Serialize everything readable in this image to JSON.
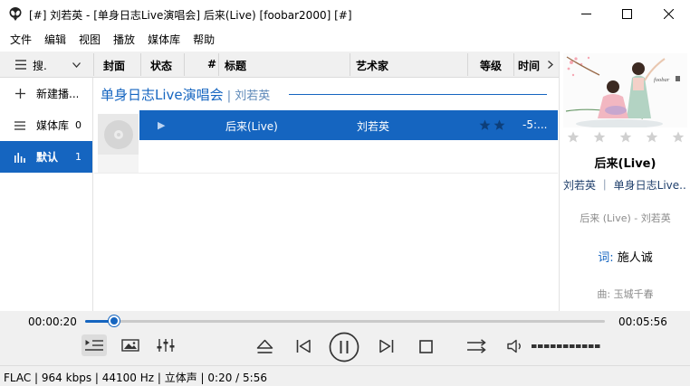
{
  "window": {
    "title": "[#] 刘若英 - [单身日志Live演唱会] 后来(Live)  [foobar2000] [#]"
  },
  "menu": [
    "文件",
    "编辑",
    "视图",
    "播放",
    "媒体库",
    "帮助"
  ],
  "columns": {
    "search": "搜.",
    "cover": "封面",
    "status": "状态",
    "number": "#",
    "title": "标题",
    "artist": "艺术家",
    "rating": "等级",
    "time": "时间"
  },
  "sidebar": {
    "items": [
      {
        "label": "新建播...",
        "icon": "plus-icon",
        "count": ""
      },
      {
        "label": "媒体库",
        "icon": "list-icon",
        "count": "0"
      },
      {
        "label": "默认",
        "icon": "bars-icon",
        "count": "1"
      }
    ]
  },
  "playlist": {
    "group_album": "单身日志Live演唱会",
    "group_sep": " | ",
    "group_artist": "刘若英",
    "rows": [
      {
        "status": "▶",
        "title": "后来(Live)",
        "artist": "刘若英",
        "time": "-5:..."
      }
    ]
  },
  "now_playing": {
    "title": "后来(Live)",
    "meta": "刘若英 ｜ 单身日志Live...",
    "subtitle": "后来 (Live) - 刘若英",
    "lyric_key": "词:",
    "lyric_value": "施人诚",
    "lyric2": "曲:  玉城千春",
    "art_text": "foobar"
  },
  "transport": {
    "elapsed": "00:00:20",
    "total": "00:05:56",
    "progress": 0.056
  },
  "status_bar": {
    "text": "FLAC | 964 kbps | 44100 Hz | 立体声 | 0:20 / 5:56"
  },
  "colors": {
    "accent": "#1565c0",
    "panel": "#f0f0f0"
  }
}
